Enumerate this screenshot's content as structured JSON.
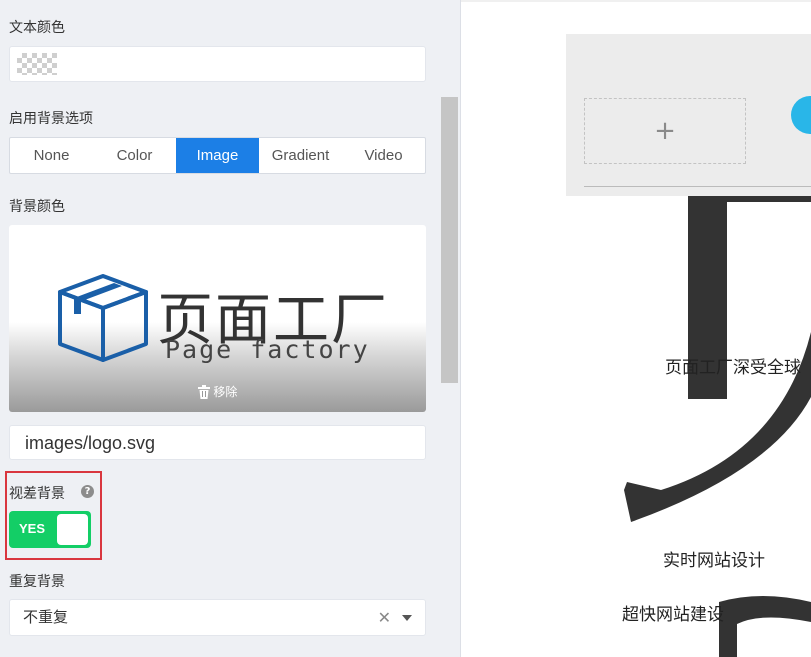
{
  "panel": {
    "text_color_label": "文本颜色",
    "enable_bg_label": "启用背景选项",
    "bg_options": [
      "None",
      "Color",
      "Image",
      "Gradient",
      "Video"
    ],
    "bg_option_selected": "Image",
    "bg_color_label": "背景颜色",
    "preview": {
      "logo_cn": "页面工厂",
      "logo_en": "Page factory",
      "remove_label": "移除"
    },
    "image_path": "images/logo.svg",
    "parallax_label": "视差背景",
    "parallax_toggle": "YES",
    "repeat_label": "重复背景",
    "repeat_value": "不重复"
  },
  "canvas": {
    "add_symbol": "+",
    "text1": "页面工厂深受全球",
    "text2": "实时网站设计",
    "text3": "超快网站建设"
  },
  "colors": {
    "accent": "#1c7fe6",
    "toggle_on": "#13ce66",
    "highlight": "#d9363e",
    "logo_blue": "#1a5fa8",
    "circle": "#29b6e8"
  }
}
